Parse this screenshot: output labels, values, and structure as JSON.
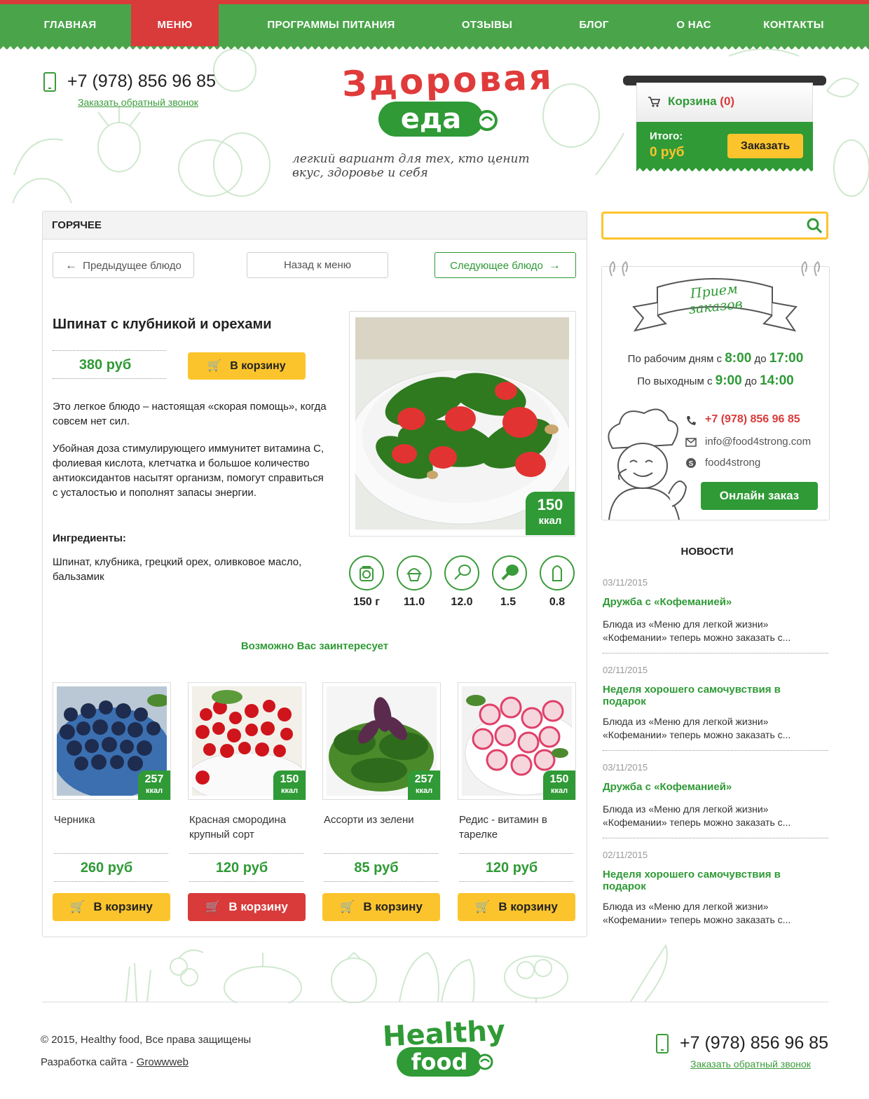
{
  "nav": {
    "items": [
      {
        "label": "ГЛАВНАЯ"
      },
      {
        "label": "МЕНЮ"
      },
      {
        "label": "ПРОГРАММЫ ПИТАНИЯ"
      },
      {
        "label": "ОТЗЫВЫ"
      },
      {
        "label": "БЛОГ"
      },
      {
        "label": "О НАС"
      },
      {
        "label": "КОНТАКТЫ"
      }
    ],
    "active_index": 1
  },
  "header": {
    "phone": "+7 (978) 856 96 85",
    "callback": "Заказать обратный звонок",
    "logo_line1": "Здоровая",
    "logo_line2": "еда",
    "tagline": "легкий вариант для тех, кто ценит вкус, здоровье и себя"
  },
  "cart": {
    "label": "Корзина",
    "count": "(0)",
    "total_label": "Итого:",
    "total_value": "0 руб",
    "order_button": "Заказать"
  },
  "category": {
    "title": "ГОРЯЧЕЕ"
  },
  "dish_nav": {
    "prev": "Предыдущее блюдо",
    "back": "Назад к меню",
    "next": "Следующее блюдо"
  },
  "dish": {
    "title": "Шпинат с клубникой и орехами",
    "price": "380 руб",
    "add_to_cart": "В корзину",
    "description_1": "Это легкое блюдо – настоящая «скорая помощь», когда совсем нет сил.",
    "description_2": "Убойная доза стимулирующего иммунитет витамина С, фолиевая кислота, клетчатка и большое количество антиоксидантов насытят организм, помогут справиться с усталостью и пополнят запасы энергии.",
    "ingredients_label": "Ингредиенты:",
    "ingredients": "Шпинат, клубника, грецкий орех, оливковое масло, бальзамик",
    "kcal_value": "150",
    "kcal_unit": "ккал",
    "nutrition": [
      {
        "icon": "scale-icon",
        "value": "150 г"
      },
      {
        "icon": "cupcake-icon",
        "value": "11.0"
      },
      {
        "icon": "drumstick-outline-icon",
        "value": "12.0"
      },
      {
        "icon": "drumstick-filled-icon",
        "value": "1.5"
      },
      {
        "icon": "salt-shaker-icon",
        "value": "0.8"
      }
    ]
  },
  "related": {
    "heading": "Возможно Вас заинтересует",
    "items": [
      {
        "title": "Черника",
        "price": "260 руб",
        "kcal": "257",
        "unit": "ккал",
        "button": "В корзину",
        "image": "blueberries"
      },
      {
        "title": "Красная смородина крупный сорт",
        "price": "120 руб",
        "kcal": "150",
        "unit": "ккал",
        "button": "В корзину",
        "image": "redcurrant"
      },
      {
        "title": "Ассорти из зелени",
        "price": "85 руб",
        "kcal": "257",
        "unit": "ккал",
        "button": "В корзину",
        "image": "greens"
      },
      {
        "title": "Редис - витамин в тарелке",
        "price": "120 руб",
        "kcal": "150",
        "unit": "ккал",
        "button": "В корзину",
        "image": "radish"
      }
    ]
  },
  "orders": {
    "banner": "Прием заказов",
    "weekdays_prefix": "По рабочим дням с",
    "weekdays_from": "8:00",
    "weekdays_mid": "до",
    "weekdays_to": "17:00",
    "weekend_prefix": "По выходным с",
    "weekend_from": "9:00",
    "weekend_mid": "до",
    "weekend_to": "14:00",
    "phone": "+7 (978) 856 96 85",
    "email": "info@food4strong.com",
    "skype": "food4strong",
    "online_button": "Онлайн заказ"
  },
  "news": {
    "heading": "НОВОСТИ",
    "items": [
      {
        "date": "03/11/2015",
        "title": "Дружба с «Кофеманией»",
        "text": "Блюда из «Меню для легкой жизни» «Кофемании» теперь можно заказать с..."
      },
      {
        "date": "02/11/2015",
        "title": "Неделя хорошего самочувствия в подарок",
        "text": "Блюда из «Меню для легкой жизни» «Кофемании» теперь можно заказать с..."
      },
      {
        "date": "03/11/2015",
        "title": "Дружба с «Кофеманией»",
        "text": "Блюда из «Меню для легкой жизни» «Кофемании» теперь можно заказать с..."
      },
      {
        "date": "02/11/2015",
        "title": "Неделя хорошего самочувствия в подарок",
        "text": "Блюда из «Меню для легкой жизни» «Кофемании» теперь можно заказать с..."
      }
    ]
  },
  "footer": {
    "copyright": "© 2015, Healthy food, Все права защищены",
    "dev_prefix": "Разработка сайта - ",
    "dev_link": "Growwweb",
    "logo_line1": "Healthy",
    "logo_line2": "food",
    "phone": "+7 (978) 856 96 85",
    "callback": "Заказать обратный звонок"
  },
  "colors": {
    "green": "#2f9a36",
    "nav_green": "#4aa54a",
    "red": "#d93a3a",
    "yellow": "#fcc42c"
  }
}
